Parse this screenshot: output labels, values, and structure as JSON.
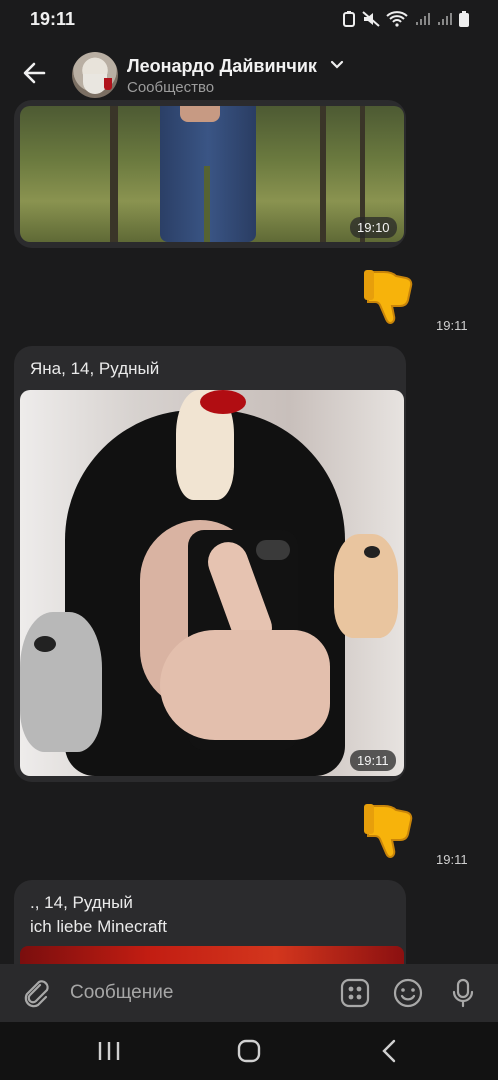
{
  "status_bar": {
    "time": "19:11"
  },
  "header": {
    "title": "Леонардо Дайвинчик",
    "subtitle": "Сообщество"
  },
  "messages": [
    {
      "type": "photo",
      "time": "19:10"
    },
    {
      "type": "sticker",
      "icon": "thumbs-down-emoji",
      "time": "19:11"
    },
    {
      "type": "photo",
      "caption": "Яна, 14, Рудный",
      "time": "19:11"
    },
    {
      "type": "sticker",
      "icon": "thumbs-down-emoji",
      "time": "19:11"
    },
    {
      "type": "photo",
      "caption_lines": [
        ".,  14, Рудный",
        "ich liebe Minecraft"
      ]
    }
  ],
  "input": {
    "placeholder": "Сообщение"
  },
  "colors": {
    "background": "#1b1b1c",
    "bubble": "#2b2b2d",
    "thumbs_yellow": "#f7b30b"
  }
}
